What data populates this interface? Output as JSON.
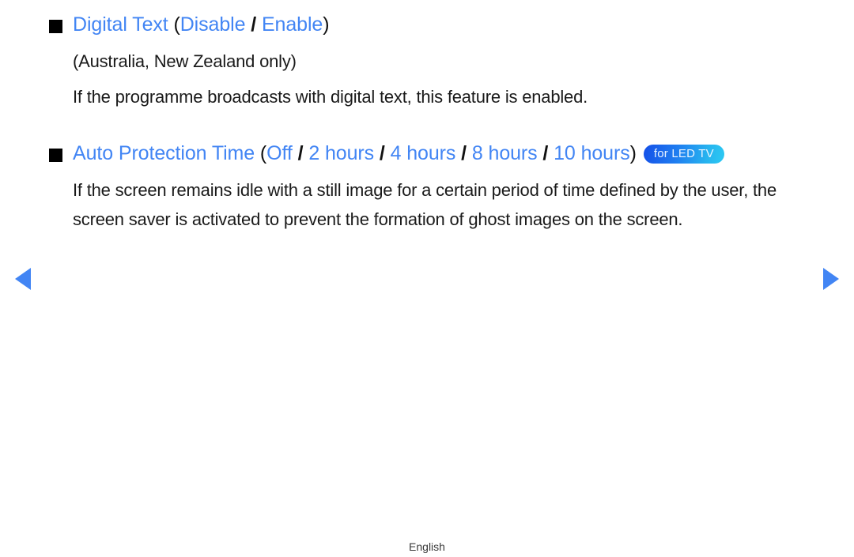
{
  "page": {
    "background_color": "#ffffff",
    "accent_color": "#4285f4",
    "text_color": "#1a1a1a"
  },
  "sections": [
    {
      "bullet_icon": "filled-square-bullet",
      "heading": {
        "title": "Digital Text",
        "open_paren": "(",
        "options": [
          "Disable",
          "Enable"
        ],
        "separator": "/",
        "close_paren": ")"
      },
      "paragraphs": [
        "(Australia, New Zealand only)",
        "If the programme broadcasts with digital text, this feature is enabled."
      ]
    },
    {
      "bullet_icon": "filled-square-bullet",
      "heading": {
        "title": "Auto Protection Time",
        "open_paren": "(",
        "options": [
          "Off",
          "2 hours",
          "4 hours",
          "8 hours",
          "10 hours"
        ],
        "separator": "/",
        "close_paren": ")"
      },
      "badge": {
        "label": "for LED TV",
        "gradient_from": "#1550e8",
        "gradient_to": "#2ccaf3",
        "text_color": "#e9f4ff"
      },
      "paragraphs": [
        "If the screen remains idle with a still image for a certain period of time defined by the user, the screen saver is activated to prevent the formation of ghost images on the screen."
      ]
    }
  ],
  "navigation": {
    "prev_label": "previous-page",
    "next_label": "next-page",
    "arrow_color": "#4285f4"
  },
  "footer": {
    "language": "English"
  }
}
